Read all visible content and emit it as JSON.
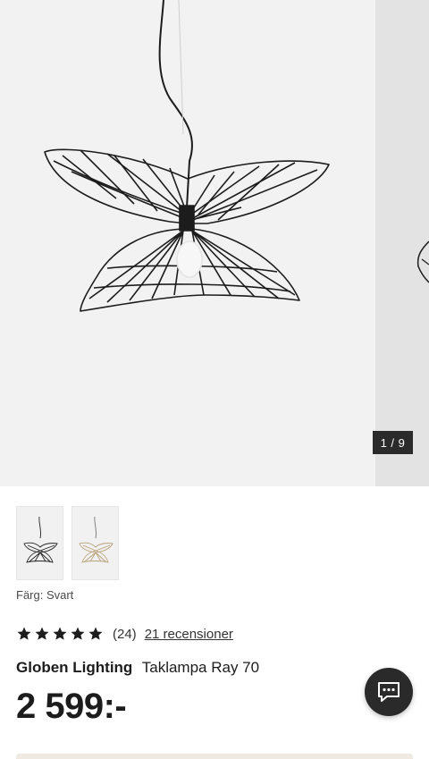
{
  "gallery": {
    "counter": "1 / 9",
    "lamp_color": "#1c1c1c"
  },
  "thumbnails": [
    {
      "variant": "black",
      "color": "#222222"
    },
    {
      "variant": "gold",
      "color": "#b9a27a"
    }
  ],
  "color_selection": {
    "label": "Färg: Svart"
  },
  "rating": {
    "stars": 5,
    "count": "(24)",
    "reviews_link": "21 recensioner"
  },
  "product": {
    "brand": "Globen Lighting",
    "name": "Taklampa Ray 70",
    "price": "2 599:-"
  },
  "chat": {
    "icon": "chat-bubble-icon"
  }
}
